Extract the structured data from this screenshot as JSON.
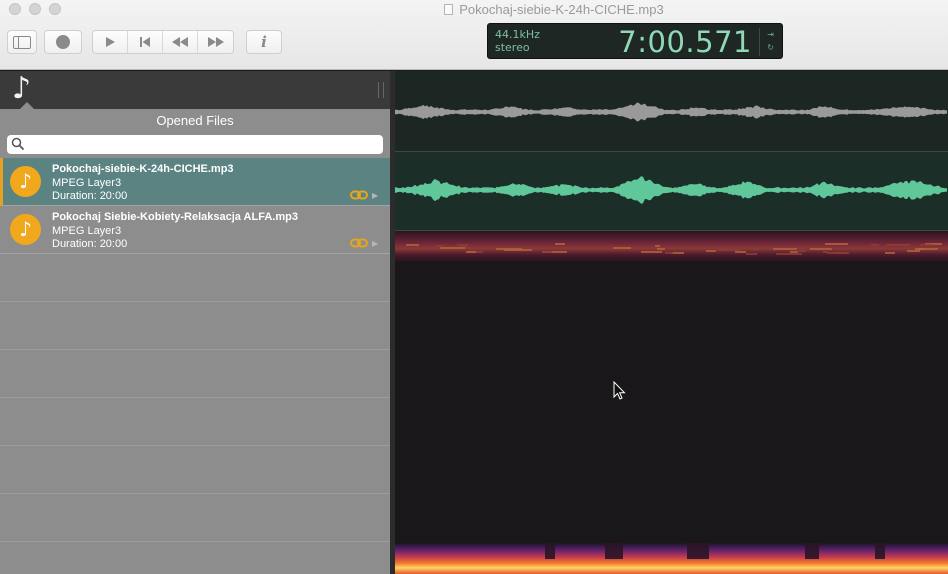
{
  "window": {
    "title": "Pokochaj-siebie-K-24h-CICHE.mp3"
  },
  "toolbar": {
    "buttons": [
      {
        "name": "sidebar-toggle",
        "icon": "sidebar-icon"
      },
      {
        "name": "record",
        "icon": "record-icon"
      },
      {
        "name": "play",
        "icon": "play-icon"
      },
      {
        "name": "skip-to-start",
        "icon": "skip-back-icon"
      },
      {
        "name": "rewind",
        "icon": "rewind-icon"
      },
      {
        "name": "fast-forward",
        "icon": "fast-forward-icon"
      },
      {
        "name": "info",
        "icon": "info-icon",
        "label": "i"
      }
    ]
  },
  "display": {
    "sample_rate": "44.1kHz",
    "channels": "stereo",
    "time": "7:00.571"
  },
  "sidebar": {
    "heading": "Opened Files",
    "search": {
      "value": "",
      "placeholder": ""
    },
    "files": [
      {
        "name": "Pokochaj-siebie-K-24h-CICHE.mp3",
        "type": "MPEG Layer3",
        "duration": "Duration: 20:00",
        "selected": true
      },
      {
        "name": "Pokochaj Siebie-Kobiety-Relaksacja ALFA.mp3",
        "type": "MPEG Layer3",
        "duration": "Duration: 20:00",
        "selected": false
      }
    ]
  },
  "colors": {
    "accent": "#f2a81c",
    "selection": "#5b8382",
    "waveform_active": "#5fc79a",
    "waveform_inactive": "#9a9a9a",
    "lcd_text": "#8fd9b6"
  }
}
